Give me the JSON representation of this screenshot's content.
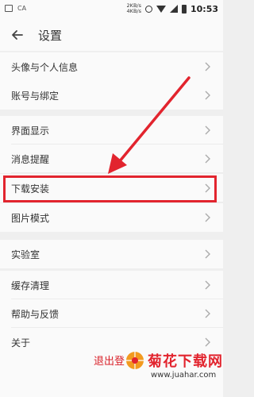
{
  "status_bar": {
    "left_text": "CA",
    "speed_up": "2KB/s",
    "speed_down": "4KB/s",
    "time": "10:53"
  },
  "header": {
    "title": "设置"
  },
  "menu": {
    "items": [
      {
        "label": "头像与个人信息"
      },
      {
        "label": "账号与绑定"
      },
      {
        "label": "界面显示"
      },
      {
        "label": "消息提醒"
      },
      {
        "label": "下载安装"
      },
      {
        "label": "图片模式"
      },
      {
        "label": "实验室"
      },
      {
        "label": "缓存清理"
      },
      {
        "label": "帮助与反馈"
      },
      {
        "label": "关于"
      }
    ]
  },
  "logout": {
    "label": "退出登"
  },
  "watermark": {
    "brand": "菊花下载网",
    "url": "www.juahar.com"
  },
  "colors": {
    "highlight": "#e2242e",
    "logout_text": "#d9232b"
  }
}
